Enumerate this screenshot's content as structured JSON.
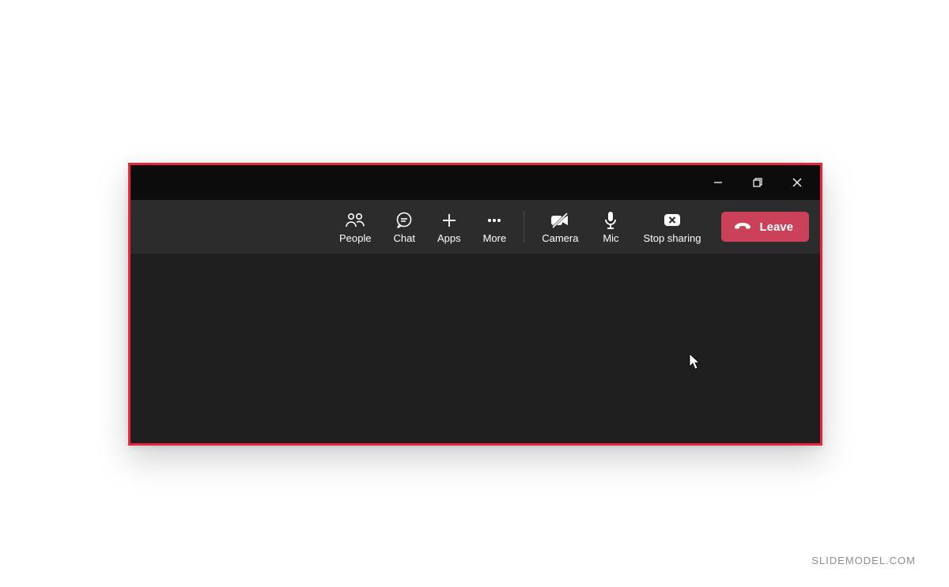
{
  "window": {
    "minimize_name": "minimize",
    "maximize_name": "maximize",
    "close_name": "close"
  },
  "toolbar": {
    "people": "People",
    "chat": "Chat",
    "apps": "Apps",
    "more": "More",
    "camera": "Camera",
    "mic": "Mic",
    "stop_sharing": "Stop sharing",
    "leave": "Leave"
  },
  "colors": {
    "border": "#E72642",
    "leave_bg": "#CA4159",
    "toolbar_bg": "#2c2c2c",
    "body_bg": "#1f1f1f"
  },
  "watermark": "SLIDEMODEL.COM"
}
